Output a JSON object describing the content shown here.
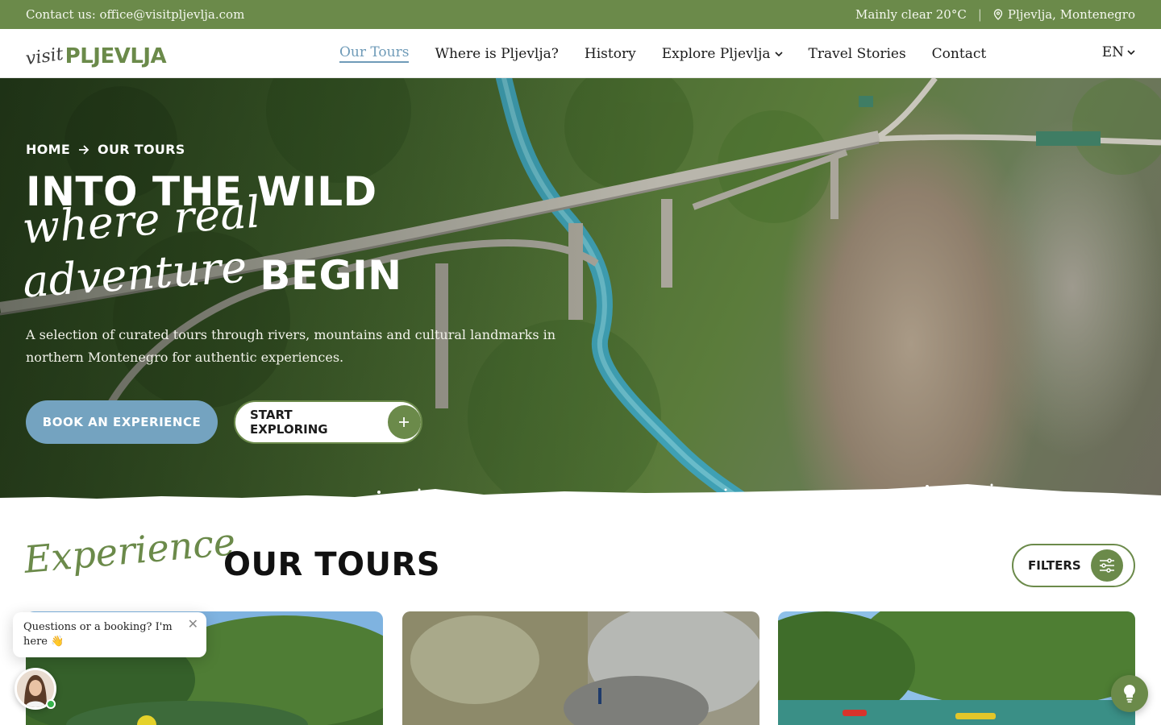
{
  "topbar": {
    "contact": "Contact us: office@visitpljevlja.com",
    "weather": "Mainly clear 20°C",
    "separator": "|",
    "location": "Pljevlja, Montenegro"
  },
  "logo": {
    "script": "visit",
    "wordmark": "PLJEVLJA"
  },
  "nav": {
    "items": [
      {
        "label": "Our Tours"
      },
      {
        "label": "Where is Pljevlja?"
      },
      {
        "label": "History"
      },
      {
        "label": "Explore Pljevlja"
      },
      {
        "label": "Travel Stories"
      },
      {
        "label": "Contact"
      }
    ],
    "language": "EN"
  },
  "hero": {
    "breadcrumb": [
      "HOME",
      "OUR TOURS"
    ],
    "title_line1": "INTO THE WILD",
    "title_script1": "where real",
    "title_script2": "adventure",
    "title_bold2": "BEGIN",
    "lead": "A selection of curated tours through rivers, mountains and cultural landmarks in northern Montenegro for authentic experiences.",
    "btn_book": "BOOK AN EXPERIENCE",
    "btn_explore": "START EXPLORING"
  },
  "tours_section": {
    "script": "Experience",
    "title": "OUR TOURS",
    "filters": "FILTERS"
  },
  "chat": {
    "text": "Questions or a booking? I'm here 👋"
  },
  "icons": {
    "location": "map-pin-icon",
    "breadcrumb_arrow": "arrow-right-icon",
    "plus": "plus-icon",
    "filters": "sliders-icon",
    "close": "close-icon",
    "assistant": "lightbulb-icon"
  },
  "colors": {
    "brand_green": "#6b8a4a",
    "accent_blue": "#74a3c0",
    "active_nav": "#6f9bb8"
  }
}
